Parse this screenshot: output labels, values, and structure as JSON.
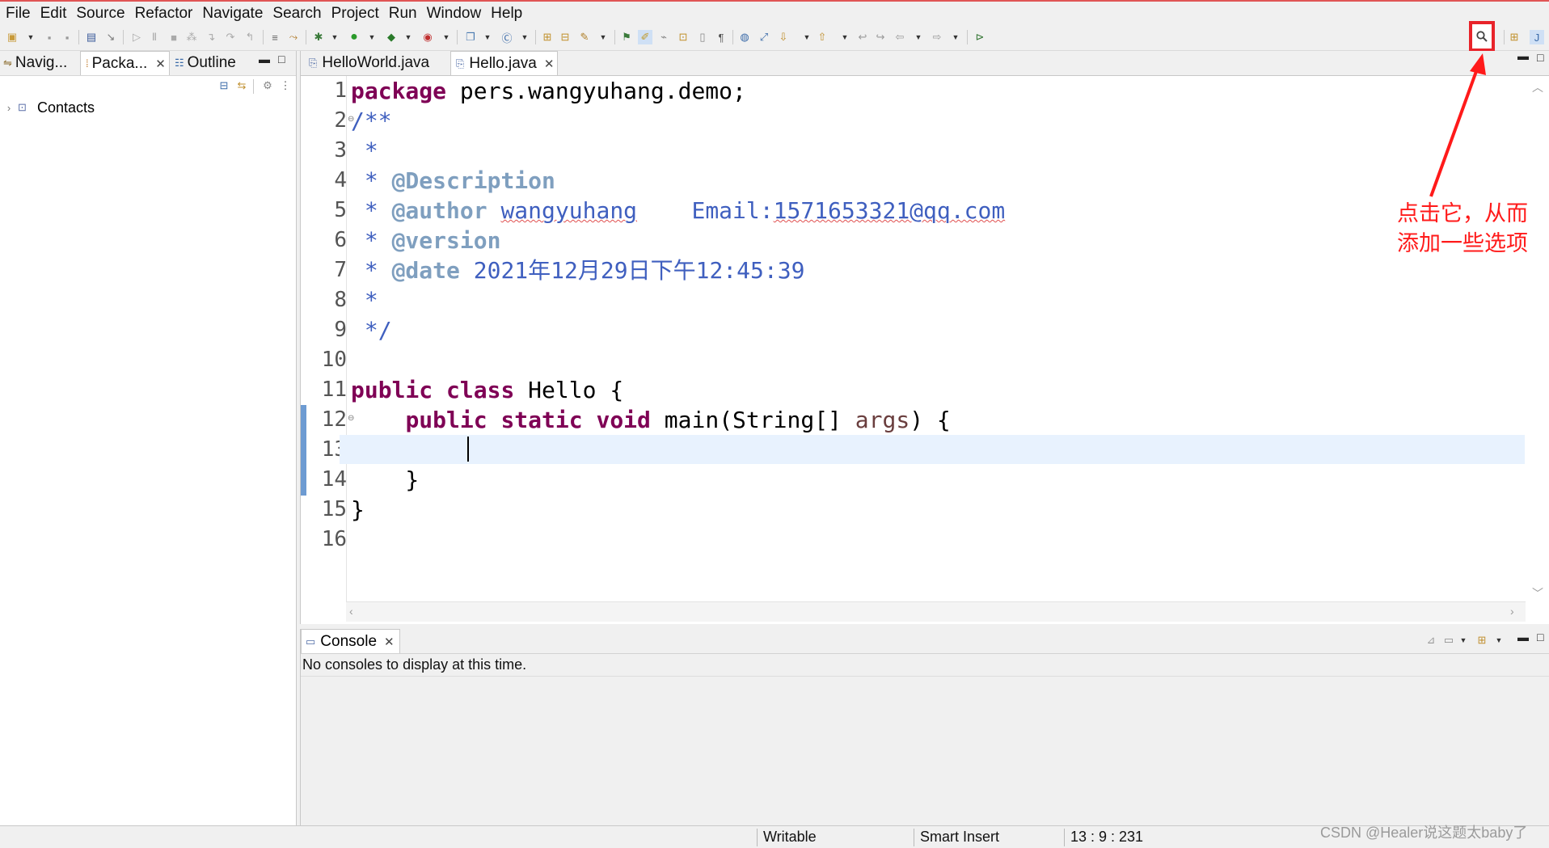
{
  "menubar": {
    "items": [
      "File",
      "Edit",
      "Source",
      "Refactor",
      "Navigate",
      "Search",
      "Project",
      "Run",
      "Window",
      "Help"
    ]
  },
  "toolbar": {
    "search_icon": "magnifier-icon"
  },
  "left_panel": {
    "tabs": [
      {
        "label": "Navig...",
        "icon": "navigator-icon"
      },
      {
        "label": "Packa...",
        "icon": "package-explorer-icon"
      },
      {
        "label": "Outline",
        "icon": "outline-icon"
      }
    ],
    "tree": [
      {
        "label": "Contacts",
        "icon": "java-project-icon"
      }
    ]
  },
  "editor": {
    "tabs": [
      {
        "label": "HelloWorld.java",
        "active": false
      },
      {
        "label": "Hello.java",
        "active": true
      }
    ],
    "line_numbers": [
      "1",
      "2",
      "3",
      "4",
      "5",
      "6",
      "7",
      "8",
      "9",
      "10",
      "11",
      "12",
      "13",
      "14",
      "15",
      "16"
    ],
    "code": {
      "l1_kw": "package",
      "l1_rest": " pers.wangyuhang.demo;",
      "l2": "/**",
      "l3": " *",
      "l4_star": " * ",
      "l4_tag": "@Description",
      "l5_star": " * ",
      "l5_tag": "@author",
      "l5_space": " ",
      "l5_name": "wangyuhang",
      "l5_email_pre": "    Email:",
      "l5_email": "1571653321@qq.com",
      "l6_star": " * ",
      "l6_tag": "@version",
      "l7_star": " * ",
      "l7_tag": "@date",
      "l7_rest": " 2021年12月29日下午12:45:39",
      "l8": " *",
      "l9": " */",
      "l11_kw1": "public",
      "l11_kw2": "class",
      "l11_rest": " Hello {",
      "l12_indent": "    ",
      "l12_kw1": "public",
      "l12_kw2": "static",
      "l12_kw3": "void",
      "l12_mid": " main(String[] ",
      "l12_param": "args",
      "l12_end": ") {",
      "l14": "    }",
      "l15": "}"
    }
  },
  "console": {
    "tab_label": "Console",
    "message": "No consoles to display at this time."
  },
  "statusbar": {
    "writable": "Writable",
    "insert_mode": "Smart Insert",
    "position": "13 : 9 : 231"
  },
  "watermark": "CSDN @Healer说这题太baby了",
  "annotation": {
    "line1": "点击它，从而",
    "line2": "添加一些选项",
    "color": "#ff1a1a"
  }
}
